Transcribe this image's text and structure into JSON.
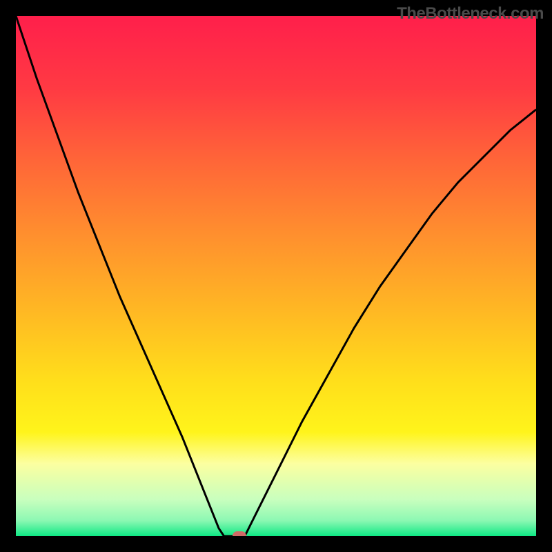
{
  "watermark": "TheBottleneck.com",
  "chart_data": {
    "type": "line",
    "title": "",
    "xlabel": "",
    "ylabel": "",
    "xlim": [
      0,
      100
    ],
    "ylim": [
      0,
      100
    ],
    "background_gradient": {
      "direction": "vertical",
      "stops": [
        {
          "pos": 0.0,
          "color": "#ff1f4b"
        },
        {
          "pos": 0.14,
          "color": "#ff3a43"
        },
        {
          "pos": 0.28,
          "color": "#ff6638"
        },
        {
          "pos": 0.42,
          "color": "#ff8f2e"
        },
        {
          "pos": 0.56,
          "color": "#ffb624"
        },
        {
          "pos": 0.7,
          "color": "#ffde1b"
        },
        {
          "pos": 0.8,
          "color": "#fff41b"
        },
        {
          "pos": 0.86,
          "color": "#fcffa0"
        },
        {
          "pos": 0.93,
          "color": "#c8ffbe"
        },
        {
          "pos": 0.97,
          "color": "#8cf8b3"
        },
        {
          "pos": 1.0,
          "color": "#0ee884"
        }
      ]
    },
    "series": [
      {
        "name": "left-branch",
        "x": [
          0,
          4,
          8,
          12,
          16,
          20,
          24,
          28,
          32,
          34,
          36,
          38,
          39,
          40
        ],
        "y": [
          100,
          88,
          77,
          66,
          56,
          46,
          37,
          28,
          19,
          14,
          9,
          4,
          1.5,
          0
        ]
      },
      {
        "name": "notch-flat",
        "x": [
          40,
          44
        ],
        "y": [
          0,
          0
        ]
      },
      {
        "name": "right-branch",
        "x": [
          44,
          46,
          50,
          55,
          60,
          65,
          70,
          75,
          80,
          85,
          90,
          95,
          100
        ],
        "y": [
          0,
          4,
          12,
          22,
          31,
          40,
          48,
          55,
          62,
          68,
          73,
          78,
          82
        ]
      }
    ],
    "marker": {
      "x": 43,
      "y": 0,
      "color": "#cf6a66"
    }
  }
}
